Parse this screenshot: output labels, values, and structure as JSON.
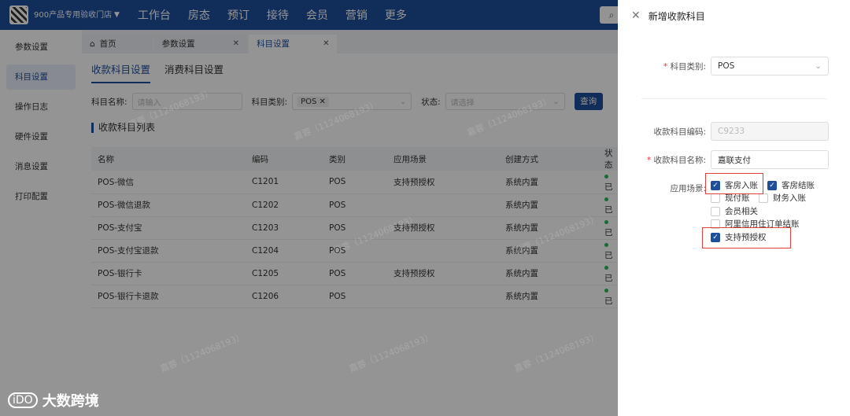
{
  "brand": {
    "name": "900产品专用验收门店"
  },
  "nav": [
    "工作台",
    "房态",
    "预订",
    "接待",
    "会员",
    "营销",
    "更多"
  ],
  "sidebar": [
    "参数设置",
    "科目设置",
    "操作日志",
    "硬件设置",
    "消息设置",
    "打印配置"
  ],
  "tabs": [
    {
      "label": "首页"
    },
    {
      "label": "参数设置"
    },
    {
      "label": "科目设置"
    }
  ],
  "subtabs": [
    "收款科目设置",
    "消费科目设置"
  ],
  "filters": {
    "name_label": "科目名称:",
    "name_placeholder": "请输入",
    "type_label": "科目类别:",
    "type_tag": "POS",
    "status_label": "状态:",
    "status_placeholder": "请选择",
    "query": "查询"
  },
  "list_title": "收款科目列表",
  "table": {
    "headers": [
      "名称",
      "编码",
      "类别",
      "应用场景",
      "创建方式",
      "状态"
    ],
    "rows": [
      [
        "POS-微信",
        "C1201",
        "POS",
        "支持预授权",
        "系统内置",
        "已"
      ],
      [
        "POS-微信退款",
        "C1202",
        "POS",
        "",
        "系统内置",
        "已"
      ],
      [
        "POS-支付宝",
        "C1203",
        "POS",
        "支持预授权",
        "系统内置",
        "已"
      ],
      [
        "POS-支付宝退款",
        "C1204",
        "POS",
        "",
        "系统内置",
        "已"
      ],
      [
        "POS-银行卡",
        "C1205",
        "POS",
        "支持预授权",
        "系统内置",
        "已"
      ],
      [
        "POS-银行卡退款",
        "C1206",
        "POS",
        "",
        "系统内置",
        "已"
      ]
    ]
  },
  "watermark": "嘉蓉（1124068193）",
  "drawer": {
    "title": "新增收款科目",
    "type_label": "科目类别:",
    "type_value": "POS",
    "code_label": "收款科目编码:",
    "code_value": "C9233",
    "name_label": "收款科目名称:",
    "name_value": "嘉联支付",
    "scene_label": "应用场景:",
    "scenes": [
      {
        "label": "客房入账",
        "checked": true
      },
      {
        "label": "客房结账",
        "checked": true
      },
      {
        "label": "现付账",
        "checked": false
      },
      {
        "label": "财务入账",
        "checked": false
      },
      {
        "label": "会员相关",
        "checked": false
      },
      {
        "label": "阿里信用住订单结账",
        "checked": false
      },
      {
        "label": "支持预授权",
        "checked": true
      }
    ]
  },
  "footer_logo": "大数跨境",
  "footer_mark": "iDO",
  "colors": {
    "primary": "#1e4e9c",
    "highlight": "#e0413c"
  }
}
